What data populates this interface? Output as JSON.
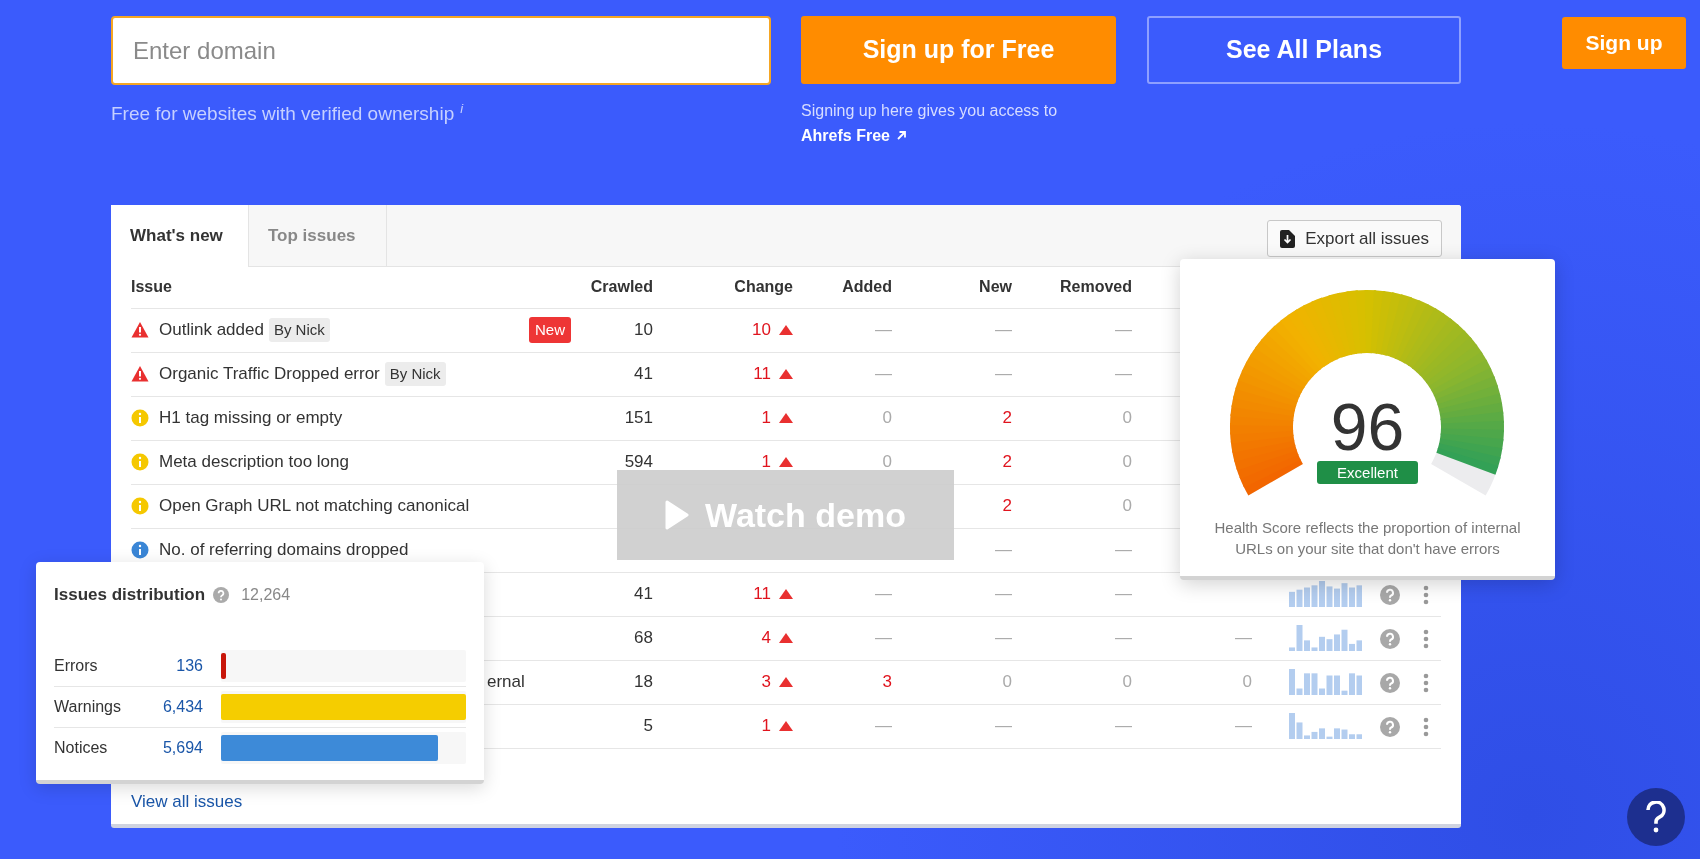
{
  "domain_field": {
    "placeholder": "Enter domain"
  },
  "domain_note": "Free for websites with verified ownership",
  "info_glyph": "i",
  "signup_button": "Sign up for Free",
  "signup_note": "Signing up here gives you access to",
  "plan_link": "Ahrefs Free",
  "plans_button": "See All Plans",
  "header_signup": "Sign up",
  "tabs": [
    {
      "label": "What's new",
      "selected": true
    },
    {
      "label": "Top issues",
      "selected": false
    }
  ],
  "export_button": "Export all issues",
  "table": {
    "columns": [
      "Issue",
      "Crawled",
      "Change",
      "Added",
      "New",
      "Removed"
    ],
    "rows": [
      {
        "kind": "error",
        "issue": "Outlink added",
        "tag": "By Nick",
        "badge": "New",
        "crawled": "10",
        "change": "10",
        "added": {
          "text": "—",
          "alert": false
        },
        "new": {
          "text": "—",
          "alert": false
        },
        "removed": {
          "text": "—",
          "alert": false
        }
      },
      {
        "kind": "error",
        "issue": "Organic Traffic Dropped error",
        "tag": "By Nick",
        "crawled": "41",
        "change": "11",
        "added": {
          "text": "—",
          "alert": false
        },
        "new": {
          "text": "—",
          "alert": false
        },
        "removed": {
          "text": "—",
          "alert": false
        }
      },
      {
        "kind": "warning",
        "issue": "H1 tag missing or empty",
        "crawled": "151",
        "change": "1",
        "added": {
          "text": "0",
          "alert": false
        },
        "new": {
          "text": "2",
          "alert": true
        },
        "removed": {
          "text": "0",
          "alert": false
        }
      },
      {
        "kind": "warning",
        "issue": "Meta description too long",
        "crawled": "594",
        "change": "1",
        "added": {
          "text": "0",
          "alert": false
        },
        "new": {
          "text": "2",
          "alert": true
        },
        "removed": {
          "text": "0",
          "alert": false
        }
      },
      {
        "kind": "warning",
        "issue": "Open Graph URL not matching canonical",
        "new": {
          "text": "2",
          "alert": true
        },
        "removed": {
          "text": "0",
          "alert": false
        }
      },
      {
        "kind": "notice",
        "issue": "No. of referring domains dropped",
        "new": {
          "text": "—",
          "alert": false
        },
        "removed": {
          "text": "—",
          "alert": false
        }
      },
      {
        "crawled": "41",
        "change": "11",
        "added": {
          "text": "—",
          "alert": false
        },
        "new": {
          "text": "—",
          "alert": false
        },
        "removed": {
          "text": "—",
          "alert": false
        },
        "extras": true
      },
      {
        "crawled": "68",
        "change": "4",
        "added": {
          "text": "—",
          "alert": false
        },
        "new": {
          "text": "—",
          "alert": false
        },
        "removed": {
          "text": "—",
          "alert": false
        },
        "column_7": {
          "text": "—",
          "alert": false
        },
        "extras": true
      },
      {
        "issue": "ernal",
        "crawled": "18",
        "change": "3",
        "added": {
          "text": "3",
          "alert": true
        },
        "new": {
          "text": "0",
          "alert": false
        },
        "removed": {
          "text": "0",
          "alert": false
        },
        "column_7": {
          "text": "0",
          "alert": false
        },
        "extras": true
      },
      {
        "crawled": "5",
        "change": "1",
        "added": {
          "text": "—",
          "alert": false
        },
        "new": {
          "text": "—",
          "alert": false
        },
        "removed": {
          "text": "—",
          "alert": false
        },
        "column_7": {
          "text": "—",
          "alert": false
        },
        "extras": true
      }
    ]
  },
  "view_all_link": "View all issues",
  "watch_demo": "Watch demo",
  "distribution": {
    "title": "Issues distribution",
    "total": "12,264",
    "rows": [
      {
        "label": "Errors",
        "count": "136",
        "level": 0.021,
        "color": "#c8160a"
      },
      {
        "label": "Warnings",
        "count": "6,434",
        "level": 1,
        "color": "#f5cd00"
      },
      {
        "label": "Notices",
        "count": "5,694",
        "level": 0.885,
        "color": "#3d8ad8"
      }
    ]
  },
  "health": {
    "score": "96",
    "rating": "Excellent",
    "description": "Health Score reflects the proportion of internal URLs on your site that don't have errors"
  }
}
